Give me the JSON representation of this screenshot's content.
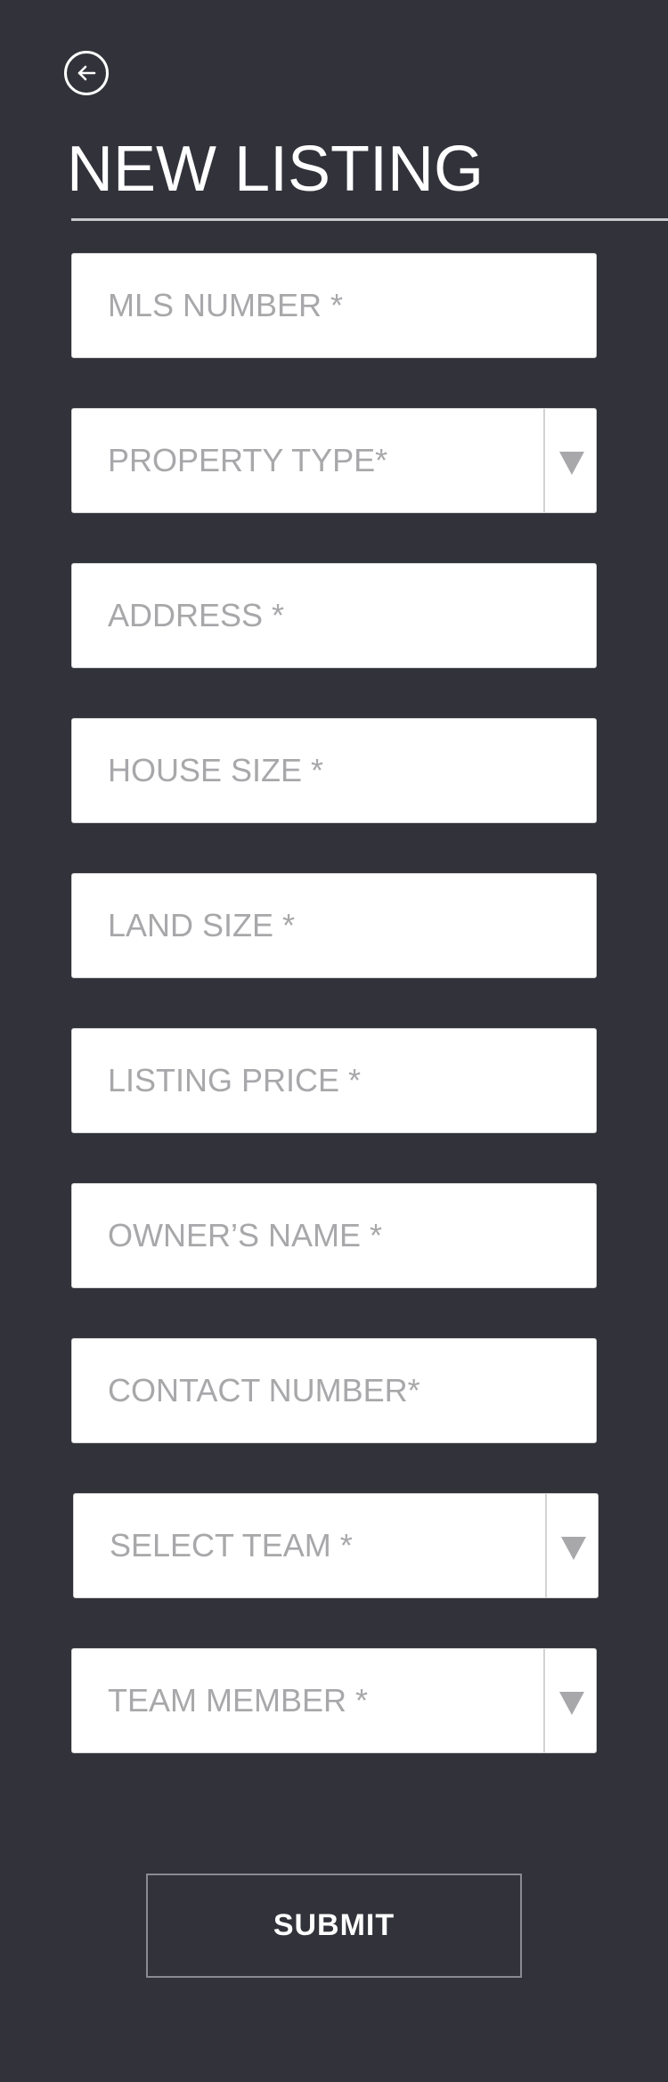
{
  "header": {
    "back_icon": "arrow-left-circle-icon",
    "title": "NEW LISTING"
  },
  "form": {
    "mls_number": {
      "placeholder": "MLS NUMBER *",
      "value": ""
    },
    "property_type": {
      "label": "PROPERTY TYPE*",
      "icon": "caret-down-icon"
    },
    "address": {
      "placeholder": "ADDRESS *",
      "value": ""
    },
    "house_size": {
      "placeholder": "HOUSE SIZE *",
      "value": ""
    },
    "land_size": {
      "placeholder": "LAND SIZE *",
      "value": ""
    },
    "listing_price": {
      "placeholder": "LISTING PRICE *",
      "value": ""
    },
    "owners_name": {
      "placeholder": "OWNER’S NAME *",
      "value": ""
    },
    "contact_number": {
      "placeholder": "CONTACT NUMBER*",
      "value": ""
    },
    "select_team": {
      "label": "SELECT TEAM *",
      "icon": "caret-down-icon"
    },
    "team_member": {
      "label": "TEAM MEMBER *",
      "icon": "caret-down-icon"
    },
    "submit_label": "SUBMIT"
  },
  "colors": {
    "background": "#32323a",
    "field_background": "#ffffff",
    "placeholder": "#a8a8ab",
    "text_light": "#ffffff"
  }
}
